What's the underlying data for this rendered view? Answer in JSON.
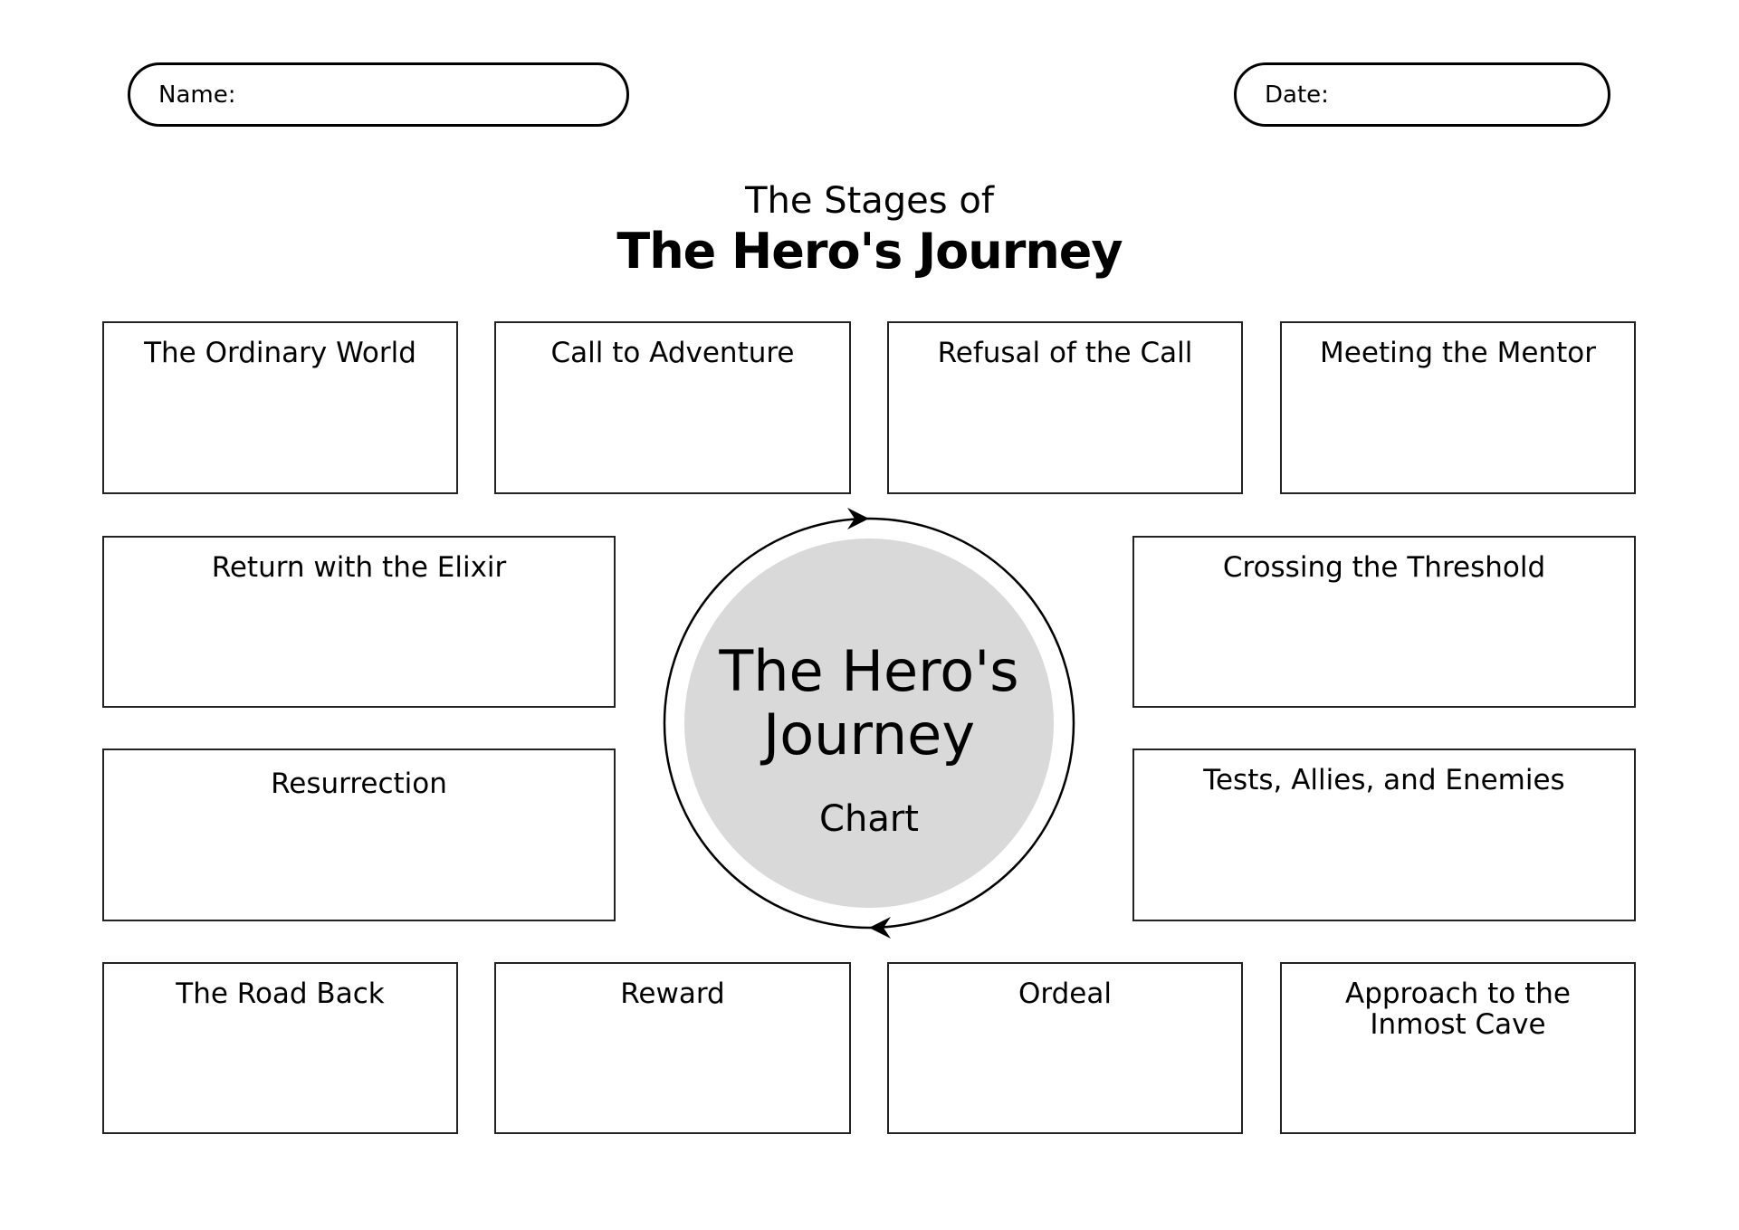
{
  "header": {
    "name_label": "Name:",
    "name_value": "",
    "date_label": "Date:",
    "date_value": ""
  },
  "title": {
    "subtitle": "The Stages of",
    "main": "The Hero's Journey"
  },
  "center": {
    "line1": "The Hero's",
    "line2": "Journey",
    "line3": "Chart",
    "fill_color": "#d9d9d9",
    "ring_color": "#000000",
    "arrows": [
      "arrow-clockwise-top",
      "arrow-clockwise-bottom"
    ]
  },
  "stages": [
    {
      "label": "The Ordinary World"
    },
    {
      "label": "Call to Adventure"
    },
    {
      "label": "Refusal of the Call"
    },
    {
      "label": "Meeting the Mentor"
    },
    {
      "label": "Crossing the Threshold"
    },
    {
      "label": "Tests, Allies, and Enemies"
    },
    {
      "label": "Approach to the Inmost Cave"
    },
    {
      "label": "Ordeal"
    },
    {
      "label": "Reward"
    },
    {
      "label": "The Road Back"
    },
    {
      "label": "Resurrection"
    },
    {
      "label": "Return with the Elixir"
    }
  ]
}
